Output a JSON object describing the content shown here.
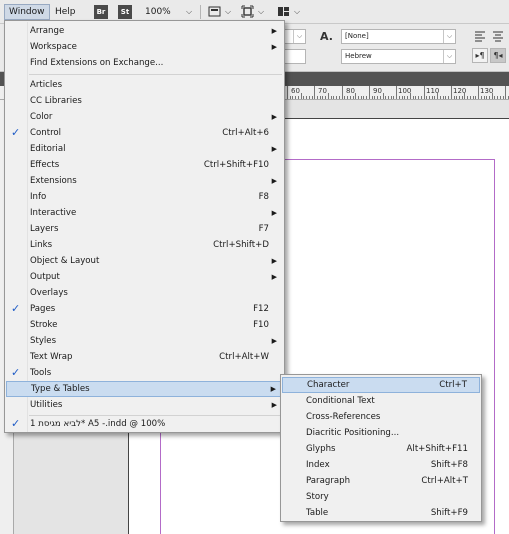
{
  "menubar": {
    "window": "Window",
    "help": "Help",
    "br": "Br",
    "st": "St",
    "zoom": "100%"
  },
  "control": {
    "char_style_glyph": "A.",
    "font_field": "[None]",
    "lang_field": "Hebrew"
  },
  "ruler": [
    "60",
    "70",
    "80",
    "90",
    "100",
    "110",
    "120",
    "130"
  ],
  "menu": {
    "arrange": "Arrange",
    "workspace": "Workspace",
    "find_extensions": "Find Extensions on Exchange...",
    "articles": "Articles",
    "cc_libraries": "CC Libraries",
    "color": "Color",
    "control": "Control",
    "control_sc": "Ctrl+Alt+6",
    "editorial": "Editorial",
    "effects": "Effects",
    "effects_sc": "Ctrl+Shift+F10",
    "extensions": "Extensions",
    "info": "Info",
    "info_sc": "F8",
    "interactive": "Interactive",
    "layers": "Layers",
    "layers_sc": "F7",
    "links": "Links",
    "links_sc": "Ctrl+Shift+D",
    "object_layout": "Object & Layout",
    "output": "Output",
    "overlays": "Overlays",
    "pages": "Pages",
    "pages_sc": "F12",
    "stroke": "Stroke",
    "stroke_sc": "F10",
    "styles": "Styles",
    "text_wrap": "Text Wrap",
    "text_wrap_sc": "Ctrl+Alt+W",
    "tools": "Tools",
    "type_tables": "Type & Tables",
    "utilities": "Utilities",
    "document": "1 לביא מגיסת* A5 -.indd @ 100%"
  },
  "submenu": {
    "character": "Character",
    "character_sc": "Ctrl+T",
    "conditional_text": "Conditional Text",
    "cross_references": "Cross-References",
    "diacritic": "Diacritic Positioning...",
    "glyphs": "Glyphs",
    "glyphs_sc": "Alt+Shift+F11",
    "index": "Index",
    "index_sc": "Shift+F8",
    "paragraph": "Paragraph",
    "paragraph_sc": "Ctrl+Alt+T",
    "story": "Story",
    "table": "Table",
    "table_sc": "Shift+F9"
  },
  "colors": {
    "highlight": "#cadcf0",
    "check": "#1e5bc6",
    "margin_guide": "#b36bc8"
  }
}
